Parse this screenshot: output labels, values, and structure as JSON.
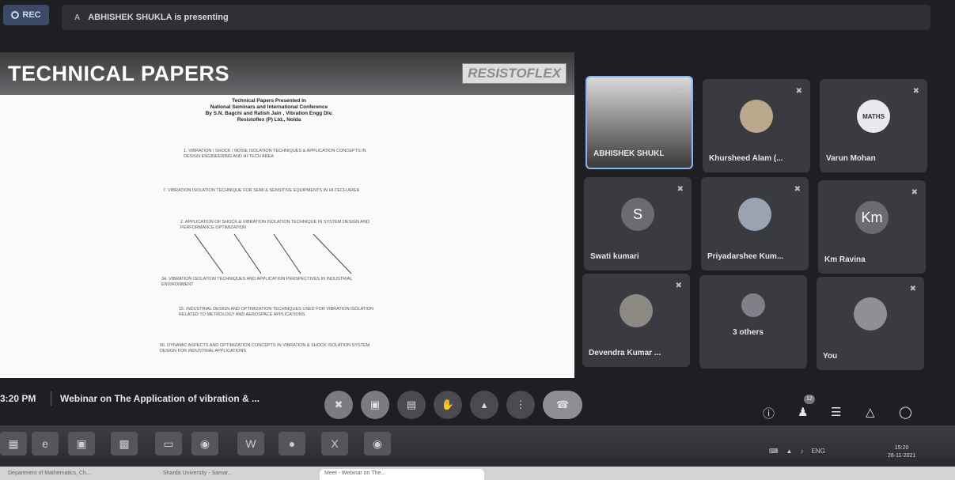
{
  "top": {
    "rec_label": "REC",
    "presenter_initial": "A",
    "presenting_text": "ABHISHEK SHUKLA is presenting"
  },
  "slide": {
    "title": "TECHNICAL PAPERS",
    "logo_text": "RESISTOFLEX",
    "heading_lines": [
      "Technical Papers Presented In",
      "National Seminars and International Conference",
      "By S.N. Bagchi and Ratish Jain , Vibration Engg Div.",
      "Resistoflex (P) Ltd., Noida"
    ],
    "items": [
      "1. VIBRATION / SHOCK / NOISE ISOLATION TECHNIQUES & APPLICATION CONCEPTS IN DESIGN ENGINEERING AND HI-TECH AREA",
      "7. VIBRATION ISOLATION TECHNIQUE FOR SEMI & SENSITIVE EQUIPMENTS IN HI-TECH AREA",
      "2. APPLICATION OF SHOCK & VIBRATION ISOLATION TECHNIQUE IN SYSTEM DESIGN AND PERFORMANCE OPTIMIZATION",
      "34. VIBRATION ISOLATION TECHNIQUES AND APPLICATION PERSPECTIVES IN INDUSTRIAL ENVIRONMENT",
      "15. INDUSTRIAL DESIGN AND OPTIMIZATION TECHNIQUES USED FOR VIBRATION ISOLATION RELATED TO METROLOGY AND AEROSPACE APPLICATIONS",
      "56. DYNAMIC ASPECTS AND OPTIMIZATION CONCEPTS IN VIBRATION & SHOCK ISOLATION SYSTEM DESIGN FOR INDUSTRIAL APPLICATIONS"
    ]
  },
  "participants": [
    {
      "name": "ABHISHEK SHUKL",
      "initial": "",
      "avatar_color": "#6e6e6e",
      "video": true
    },
    {
      "name": "Khursheed Alam (...",
      "initial": "",
      "avatar_color": "#b9a98a",
      "video": false
    },
    {
      "name": "Varun Mohan",
      "initial": "MATHS",
      "avatar_color": "#e9e9ee",
      "video": false
    },
    {
      "name": "Swati kumari",
      "initial": "S",
      "avatar_color": "#6b6c72",
      "video": false
    },
    {
      "name": "Priyadarshee Kum...",
      "initial": "",
      "avatar_color": "#9aa3b2",
      "video": false
    },
    {
      "name": "Km Ravina",
      "initial": "Km",
      "avatar_color": "#6b6c72",
      "video": false
    },
    {
      "name": "Devendra Kumar ...",
      "initial": "",
      "avatar_color": "#8d8a84",
      "video": false
    },
    {
      "name": "3 others",
      "initial": "",
      "avatar_color": "#7f8088",
      "video": false
    },
    {
      "name": "You",
      "initial": "",
      "avatar_color": "#8f8f95",
      "video": false
    }
  ],
  "bottom": {
    "time": "3:20 PM",
    "meeting_title": "Webinar on The Application of vibration & ...",
    "participant_count": "12"
  },
  "taskbar": {
    "clock_time": "15:20",
    "clock_date": "26-11-2021",
    "lang": "ENG"
  },
  "browser_tabs": [
    "Department of Mathematics, Ch...",
    "Sharda University - Samar...",
    "Meet - Webinar on The..."
  ]
}
